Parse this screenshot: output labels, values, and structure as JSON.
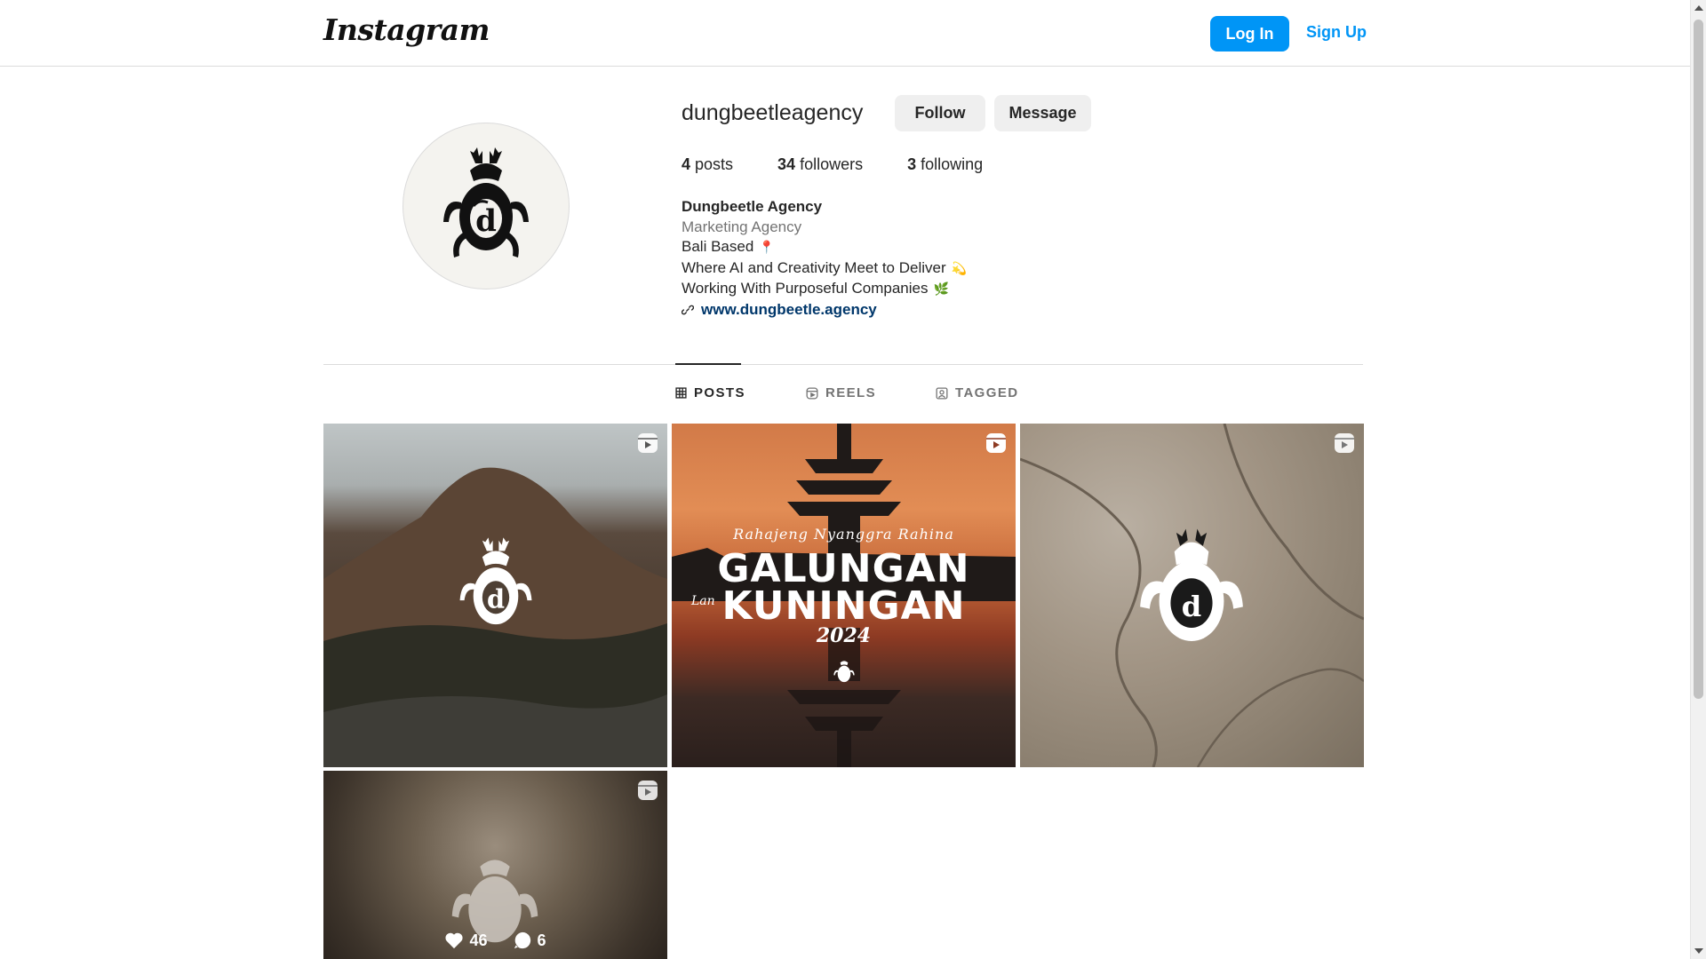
{
  "header": {
    "logo": "Instagram",
    "login_label": "Log In",
    "signup_label": "Sign Up"
  },
  "profile": {
    "username": "dungbeetleagency",
    "follow_label": "Follow",
    "message_label": "Message",
    "stats": {
      "posts_count": "4",
      "posts_label": " posts",
      "followers_count": "34",
      "followers_label": " followers",
      "following_count": "3",
      "following_label": " following"
    },
    "bio": {
      "name": "Dungbeetle Agency",
      "category": "Marketing Agency",
      "line1": "Bali Based",
      "line1_emoji": "📍",
      "line2": "Where AI and Creativity Meet to Deliver",
      "line2_emoji": "💫",
      "line3": "Working With Purposeful Companies",
      "line3_emoji": "🌿",
      "website": "www.dungbeetle.agency"
    }
  },
  "tabs": [
    {
      "label": "POSTS",
      "icon": "grid-icon",
      "active": true
    },
    {
      "label": "REELS",
      "icon": "reels-icon",
      "active": false
    },
    {
      "label": "TAGGED",
      "icon": "tagged-icon",
      "active": false
    }
  ],
  "posts": [
    {
      "type": "reel",
      "icon": "reel-icon"
    },
    {
      "type": "reel",
      "icon": "reel-icon",
      "text_script": "Rahajeng Nyanggra Rahina",
      "text_line1": "GALUNGAN",
      "text_lan": "Lan",
      "text_line2": "KUNINGAN",
      "text_year": "2024"
    },
    {
      "type": "reel",
      "icon": "reel-icon"
    },
    {
      "type": "reel",
      "icon": "reel-icon",
      "likes": "46",
      "comments": "6"
    }
  ],
  "colors": {
    "primary_blue": "#0095f6",
    "link_blue": "#00376b",
    "text": "#262626",
    "muted": "#737373",
    "border": "#dbdbdb",
    "button_gray": "#efefef"
  }
}
